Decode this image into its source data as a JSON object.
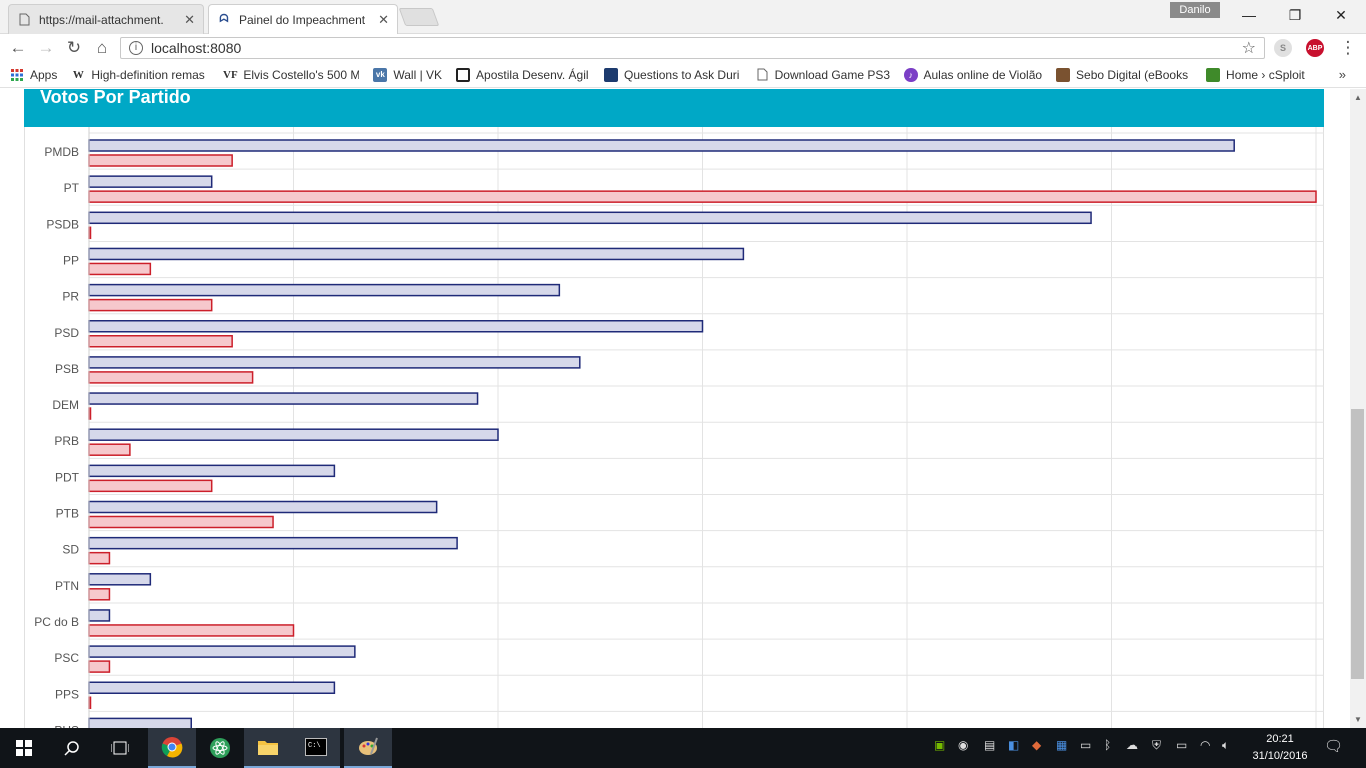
{
  "browser": {
    "tabs": [
      {
        "label": "https://mail-attachment.",
        "icon": "page-icon",
        "active": false
      },
      {
        "label": "Painel do Impeachment",
        "icon": "site-icon",
        "active": true
      }
    ],
    "profile_name": "Danilo",
    "url": "localhost:8080",
    "extensions": [
      {
        "name": "skype-icon",
        "label": "S"
      },
      {
        "name": "adblock-plus-icon",
        "label": "ABP"
      }
    ],
    "bookmarks": [
      {
        "label": "Apps",
        "icon": "apps-grid-icon"
      },
      {
        "label": "High-definition remas",
        "icon": "wikipedia-icon"
      },
      {
        "label": "Elvis Costello's 500 M",
        "icon": "vanity-fair-icon"
      },
      {
        "label": "Wall | VK",
        "icon": "vk-icon"
      },
      {
        "label": "Apostila Desenv. Ágil",
        "icon": "bookmark-icon"
      },
      {
        "label": "Questions to Ask Duri",
        "icon": "bookmark-icon"
      },
      {
        "label": "Download Game PS3",
        "icon": "page-icon"
      },
      {
        "label": "Aulas online de Violão",
        "icon": "bookmark-icon"
      },
      {
        "label": "Sebo Digital (eBooks",
        "icon": "bookmark-icon"
      },
      {
        "label": "Home › cSploit",
        "icon": "bookmark-icon"
      }
    ],
    "bookmarks_overflow": "»"
  },
  "page": {
    "panel_title": "Votos Por Partido"
  },
  "chart_data": {
    "type": "bar",
    "orientation": "horizontal",
    "title": "Votos Por Partido",
    "categories": [
      "PMDB",
      "PT",
      "PSDB",
      "PP",
      "PR",
      "PSD",
      "PSB",
      "DEM",
      "PRB",
      "PDT",
      "PTB",
      "SD",
      "PTN",
      "PC do B",
      "PSC",
      "PPS",
      "PHS"
    ],
    "series": [
      {
        "color_fill": "#d6d8ea",
        "color_stroke": "#1f2a78",
        "values": [
          56,
          6,
          49,
          32,
          23,
          30,
          24,
          19,
          20,
          12,
          17,
          18,
          3,
          1,
          13,
          12,
          5
        ]
      },
      {
        "color_fill": "#f6c8cc",
        "color_stroke": "#cc1f2a",
        "values": [
          7,
          60,
          0,
          3,
          6,
          7,
          8,
          0,
          2,
          6,
          9,
          1,
          1,
          10,
          1,
          0,
          null
        ]
      }
    ],
    "xlim": [
      0,
      60
    ],
    "grid": true,
    "gridline_step": 10,
    "legend": "none"
  },
  "taskbar": {
    "apps": [
      {
        "name": "start-icon"
      },
      {
        "name": "search-icon"
      },
      {
        "name": "task-view-icon"
      },
      {
        "name": "chrome-icon"
      },
      {
        "name": "atom-icon"
      },
      {
        "name": "file-explorer-icon"
      },
      {
        "name": "terminal-icon"
      },
      {
        "name": "paint-icon"
      }
    ],
    "time": "20:21",
    "date": "31/10/2016"
  },
  "colors": {
    "panel_header": "#00a8c6",
    "taskbar": "#101418"
  }
}
